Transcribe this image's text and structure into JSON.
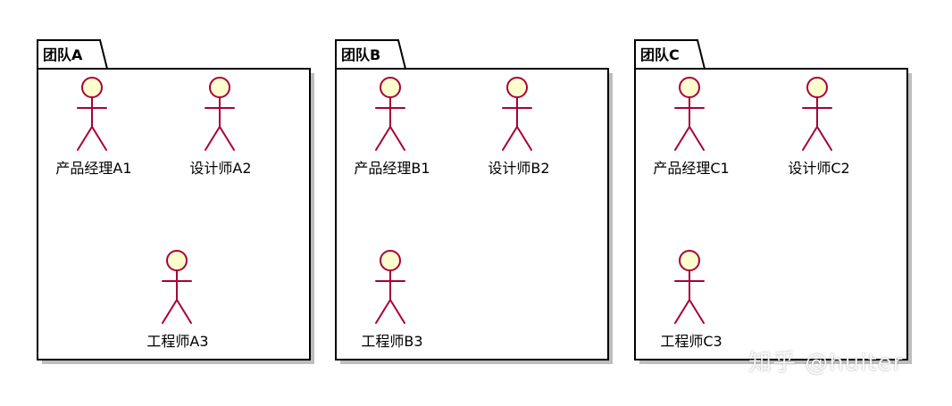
{
  "colors": {
    "actor_fill": "#FEFECE",
    "actor_stroke": "#A80036",
    "package_border": "#000000"
  },
  "packages": [
    {
      "title": "团队A",
      "actors": [
        {
          "label": "产品经理A1"
        },
        {
          "label": "设计师A2"
        },
        {
          "label": "工程师A3"
        }
      ]
    },
    {
      "title": "团队B",
      "actors": [
        {
          "label": "产品经理B1"
        },
        {
          "label": "设计师B2"
        },
        {
          "label": "工程师B3"
        }
      ]
    },
    {
      "title": "团队C",
      "actors": [
        {
          "label": "产品经理C1"
        },
        {
          "label": "设计师C2"
        },
        {
          "label": "工程师C3"
        }
      ]
    }
  ],
  "watermark": "知乎 @huiter"
}
